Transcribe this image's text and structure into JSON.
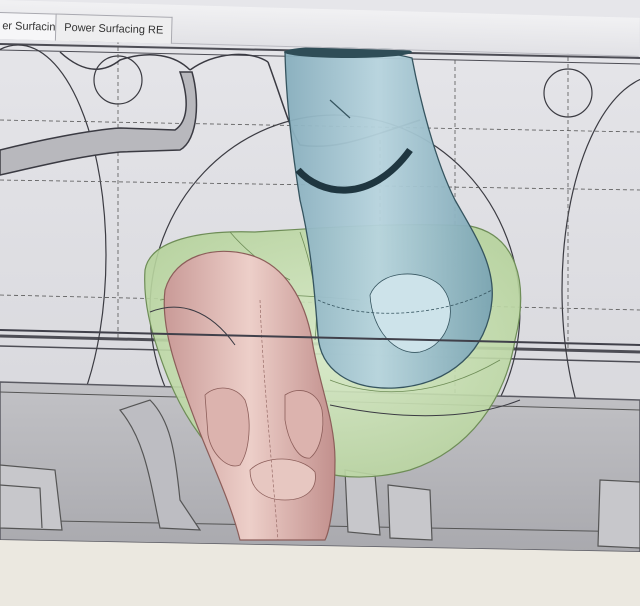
{
  "app": {
    "tabs": [
      {
        "label": "er Surfacing"
      },
      {
        "label": "Power Surfacing RE"
      }
    ]
  },
  "colors": {
    "viewport_background": "#dcdce0",
    "blue_part": "#9fc3cf",
    "green_part": "#c9dfb4",
    "pink_part": "#d9b0ad",
    "lower_table": "#b9b9bd",
    "floor": "#ebe8e0"
  },
  "icons": {
    "model_blue_part": "cylindrical-boot-model",
    "model_green_part": "ankle-shell-model",
    "model_pink_part": "foot-model"
  }
}
